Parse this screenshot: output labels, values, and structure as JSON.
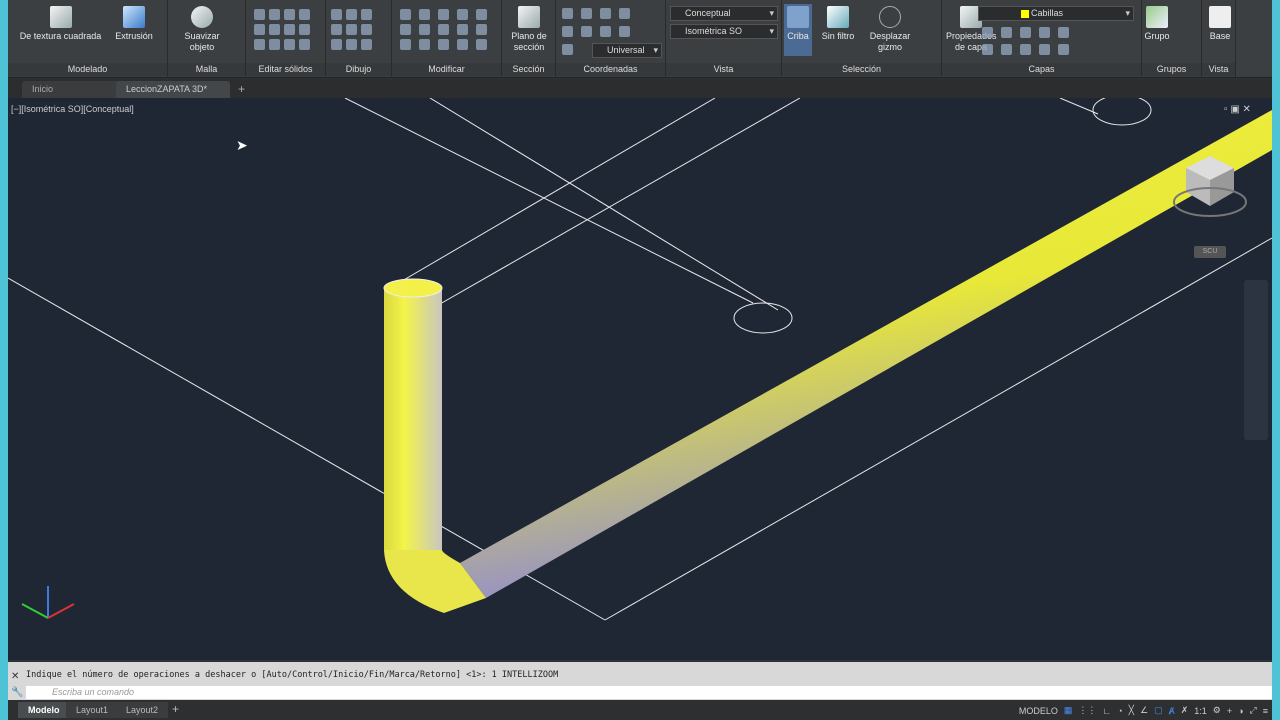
{
  "ribbon": {
    "modelado": {
      "label": "Modelado",
      "buttons": [
        "De textura cuadrada",
        "Extrusión"
      ]
    },
    "malla": {
      "label": "Malla",
      "button": "Suavizar objeto"
    },
    "editar": {
      "label": "Editar sólidos"
    },
    "dibujo": {
      "label": "Dibujo"
    },
    "modificar": {
      "label": "Modificar"
    },
    "seccion": {
      "label": "Sección",
      "button": "Plano de sección"
    },
    "coordenadas": {
      "label": "Coordenadas",
      "ucs": "Universal"
    },
    "vista": {
      "label": "Vista",
      "style": "Conceptual",
      "view": "Isométrica SO"
    },
    "seleccion": {
      "label": "Selección",
      "buttons": [
        "Criba",
        "Sin filtro",
        "Desplazar gizmo"
      ]
    },
    "capas": {
      "label": "Capas",
      "button": "Propiedades de capa",
      "layer": "Cabillas",
      "layer_color": "#ffff00"
    },
    "grupos": {
      "label": "Grupos",
      "button": "Grupo"
    },
    "vista2": {
      "label": "Vista",
      "button": "Base"
    }
  },
  "tabs": [
    {
      "label": "Inicio"
    },
    {
      "label": "LeccionZAPATA 3D*",
      "active": true
    }
  ],
  "viewport": {
    "label": "[−][Isométrica SO][Conceptual]",
    "ucs_label": "SCU"
  },
  "command": {
    "history": "Indique el número de operaciones a deshacer o [Auto/Control/Inicio/Fin/Marca/Retorno] <1>: 1 INTELLIZOOM",
    "placeholder": "Escriba un comando"
  },
  "layout_tabs": [
    "Modelo",
    "Layout1",
    "Layout2"
  ],
  "status": {
    "space": "MODELO",
    "scale": "1:1"
  }
}
